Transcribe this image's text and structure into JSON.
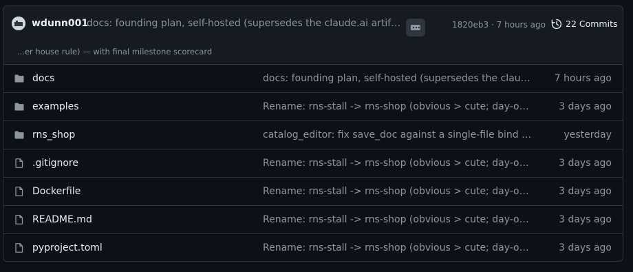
{
  "latest_commit": {
    "author": "wdunn001",
    "message": "docs: founding plan, self-hosted (supersedes the claude.ai artifact plan, which ignored the prior house rule) — with final milestone scorecard",
    "description_tail": "...er house rule) — with final milestone scorecard",
    "sha": "1820eb3",
    "separator": "·",
    "time": "7 hours ago",
    "commits_label": "22 Commits",
    "commits_icon": "history-icon"
  },
  "files": [
    {
      "name": "docs",
      "type": "folder",
      "icon": "folder-icon",
      "message": "docs: founding plan, self-hosted (supersedes the claude.ai artifact plan)",
      "age": "7 hours ago"
    },
    {
      "name": "examples",
      "type": "folder",
      "icon": "folder-icon",
      "message": "Rename: rns-stall -> rns-shop (obvious > cute; day-one is the right time)",
      "age": "3 days ago"
    },
    {
      "name": "rns_shop",
      "type": "folder",
      "icon": "folder-icon",
      "message": "catalog_editor: fix save_doc against a single-file bind mount",
      "age": "yesterday"
    },
    {
      "name": ".gitignore",
      "type": "file",
      "icon": "file-icon",
      "message": "Rename: rns-stall -> rns-shop (obvious > cute; day-one is the right time)",
      "age": "3 days ago"
    },
    {
      "name": "Dockerfile",
      "type": "file",
      "icon": "file-icon",
      "message": "Rename: rns-stall -> rns-shop (obvious > cute; day-one is the right time)",
      "age": "3 days ago"
    },
    {
      "name": "README.md",
      "type": "file",
      "icon": "file-icon",
      "message": "Rename: rns-stall -> rns-shop (obvious > cute; day-one is the right time)",
      "age": "3 days ago"
    },
    {
      "name": "pyproject.toml",
      "type": "file",
      "icon": "file-icon",
      "message": "Rename: rns-stall -> rns-shop (obvious > cute; day-one is the right time)",
      "age": "3 days ago"
    }
  ],
  "colors": {
    "background": "#0d1117",
    "header_bg": "#161b22",
    "border": "#30363d",
    "text": "#e6edf3",
    "muted": "#8d96a0",
    "icon": "#8d96a0"
  }
}
